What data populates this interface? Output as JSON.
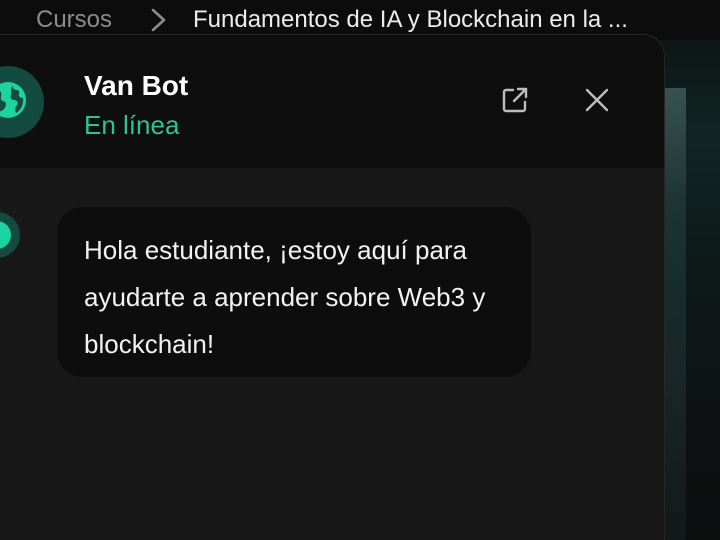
{
  "breadcrumb": {
    "parent": "Cursos",
    "current": "Fundamentos de IA y Blockchain en la ..."
  },
  "chat": {
    "bot_name": "Van Bot",
    "status": "En línea",
    "message": "Hola estudiante, ¡estoy aquí para ayudarte a aprender sobre Web3 y blockchain!"
  },
  "icons": {
    "avatar": "globe-icon",
    "separator": "chevron-right-icon",
    "open_external": "external-link-icon",
    "close": "close-icon"
  },
  "colors": {
    "accent": "#2ec393",
    "avatar_bg": "#134b40",
    "panel_bg": "#181818",
    "header_bg": "#0e0e0e",
    "bubble_bg": "#0d0d0d"
  }
}
